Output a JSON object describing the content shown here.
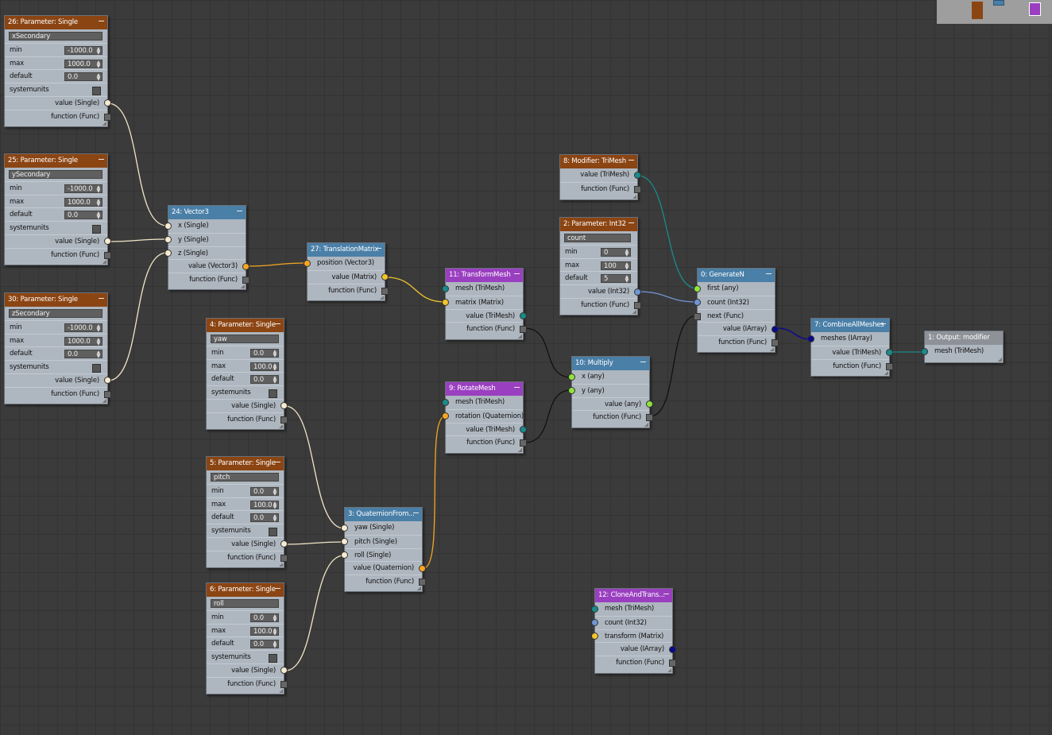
{
  "colors": {
    "background": "#3b3b3b",
    "header_param": "#8b4513",
    "header_blue": "#4a7fa7",
    "header_purple": "#9a3fc0",
    "header_gray": "#8e9298",
    "wire_single": "#f2e6c8",
    "wire_vector": "#f5a623",
    "wire_matrix": "#f3c52b",
    "wire_mesh": "#1a8a8a",
    "wire_int": "#6f95d6",
    "wire_array": "#0a0a8c",
    "wire_func": "#111111"
  },
  "nodes": {
    "n26": {
      "title": "26: Parameter: Single",
      "name": "xSecondary",
      "min_label": "min",
      "min": "-1000.0",
      "max_label": "max",
      "max": "1000.0",
      "default_label": "default",
      "default": "0.0",
      "systemunits": "systemunits",
      "value": "value (Single)",
      "function": "function (Func)"
    },
    "n25": {
      "title": "25: Parameter: Single",
      "name": "ySecondary",
      "min_label": "min",
      "min": "-1000.0",
      "max_label": "max",
      "max": "1000.0",
      "default_label": "default",
      "default": "0.0",
      "systemunits": "systemunits",
      "value": "value (Single)",
      "function": "function (Func)"
    },
    "n30": {
      "title": "30: Parameter: Single",
      "name": "zSecondary",
      "min_label": "min",
      "min": "-1000.0",
      "max_label": "max",
      "max": "1000.0",
      "default_label": "default",
      "default": "0.0",
      "systemunits": "systemunits",
      "value": "value (Single)",
      "function": "function (Func)"
    },
    "n4": {
      "title": "4: Parameter: Single",
      "name": "yaw",
      "min_label": "min",
      "min": "0.0",
      "max_label": "max",
      "max": "100.0",
      "default_label": "default",
      "default": "0.0",
      "systemunits": "systemunits",
      "value": "value (Single)",
      "function": "function (Func)"
    },
    "n5": {
      "title": "5: Parameter: Single",
      "name": "pitch",
      "min_label": "min",
      "min": "0.0",
      "max_label": "max",
      "max": "100.0",
      "default_label": "default",
      "default": "0.0",
      "systemunits": "systemunits",
      "value": "value (Single)",
      "function": "function (Func)"
    },
    "n6": {
      "title": "6: Parameter: Single",
      "name": "roll",
      "min_label": "min",
      "min": "0.0",
      "max_label": "max",
      "max": "100.0",
      "default_label": "default",
      "default": "0.0",
      "systemunits": "systemunits",
      "value": "value (Single)",
      "function": "function (Func)"
    },
    "n24": {
      "title": "24: Vector3",
      "x": "x (Single)",
      "y": "y (Single)",
      "z": "z (Single)",
      "value": "value (Vector3)",
      "function": "function (Func)"
    },
    "n27": {
      "title": "27: TranslationMatrix",
      "position": "position (Vector3)",
      "value": "value (Matrix)",
      "function": "function (Func)"
    },
    "n11": {
      "title": "11: TransformMesh",
      "mesh": "mesh (TriMesh)",
      "matrix": "matrix (Matrix)",
      "value": "value (TriMesh)",
      "function": "function (Func)"
    },
    "n9": {
      "title": "9: RotateMesh",
      "mesh": "mesh (TriMesh)",
      "rotation": "rotation (Quaternion)",
      "value": "value (TriMesh)",
      "function": "function (Func)"
    },
    "n3": {
      "title": "3: QuaternionFrom...",
      "yaw": "yaw (Single)",
      "pitch": "pitch (Single)",
      "roll": "roll (Single)",
      "value": "value (Quaternion)",
      "function": "function (Func)"
    },
    "n10": {
      "title": "10: Multiply",
      "x": "x (any)",
      "y": "y (any)",
      "value": "value (any)",
      "function": "function (Func)"
    },
    "n8": {
      "title": "8: Modifier: TriMesh",
      "value": "value (TriMesh)",
      "function": "function (Func)"
    },
    "n2": {
      "title": "2: Parameter: Int32",
      "name": "count",
      "min_label": "min",
      "min": "0",
      "max_label": "max",
      "max": "100",
      "default_label": "default",
      "default": "5",
      "value": "value (Int32)",
      "function": "function (Func)"
    },
    "n0": {
      "title": "0: GenerateN",
      "first": "first (any)",
      "count": "count (Int32)",
      "next": "next (Func)",
      "value": "value (IArray)",
      "function": "function (Func)"
    },
    "n7": {
      "title": "7: CombineAllMeshes",
      "meshes": "meshes (IArray)",
      "value": "value (TriMesh)",
      "function": "function (Func)"
    },
    "n1": {
      "title": "1: Output: modifier",
      "mesh": "mesh (TriMesh)"
    },
    "n12": {
      "title": "12: CloneAndTrans...",
      "mesh": "mesh (TriMesh)",
      "count": "count (Int32)",
      "transform": "transform (Matrix)",
      "value": "value (IArray)",
      "function": "function (Func)"
    }
  }
}
